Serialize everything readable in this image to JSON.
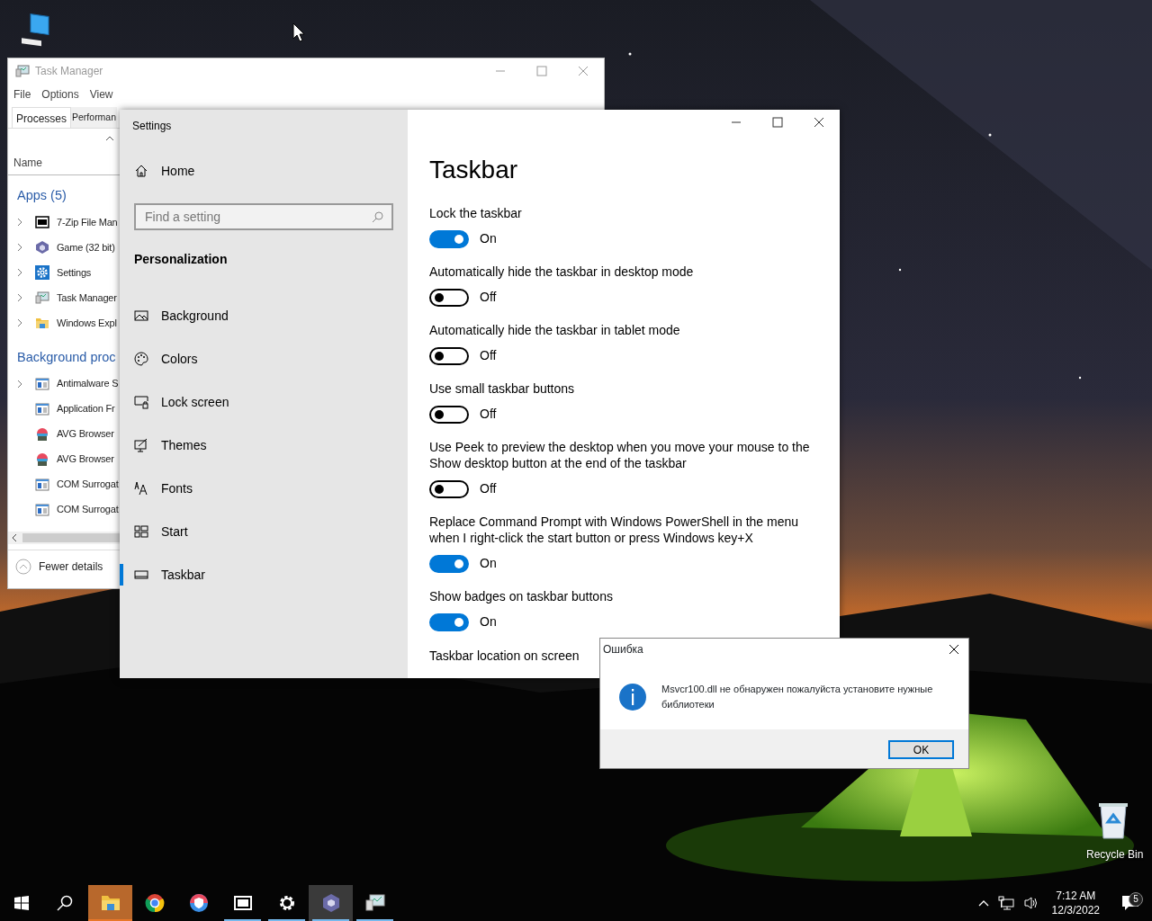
{
  "desktop_icons": [
    {
      "kind": "computer"
    },
    {
      "kind": "recycle_bin",
      "label": "Recycle Bin"
    }
  ],
  "task_manager": {
    "title": "Task Manager",
    "menu": [
      "File",
      "Options",
      "View"
    ],
    "tabs": [
      {
        "label": "Processes",
        "selected": true
      },
      {
        "label": "Performan",
        "selected": false
      }
    ],
    "column_header": "Name",
    "groups": [
      {
        "title": "Apps (5)",
        "rows": [
          {
            "label": "7-Zip File Man",
            "kind": "archive",
            "expandable": true
          },
          {
            "label": "Game (32 bit)",
            "kind": "cube",
            "expandable": true
          },
          {
            "label": "Settings",
            "kind": "gear",
            "expandable": true
          },
          {
            "label": "Task Manager",
            "kind": "monitor",
            "expandable": true
          },
          {
            "label": "Windows Expl",
            "kind": "folder",
            "expandable": true
          }
        ]
      },
      {
        "title": "Background proc",
        "rows": [
          {
            "label": "Antimalware S",
            "kind": "service",
            "expandable": true
          },
          {
            "label": "Application Fr",
            "kind": "service",
            "expandable": false
          },
          {
            "label": "AVG Browser",
            "kind": "ball",
            "expandable": false
          },
          {
            "label": "AVG Browser",
            "kind": "ball",
            "expandable": false
          },
          {
            "label": "COM Surrogat",
            "kind": "service",
            "expandable": false
          },
          {
            "label": "COM Surrogat",
            "kind": "service",
            "expandable": false
          }
        ]
      }
    ],
    "footer": "Fewer details"
  },
  "settings": {
    "title": "Settings",
    "home": "Home",
    "search": {
      "placeholder": "Find a setting"
    },
    "section": "Personalization",
    "nav": [
      {
        "label": "Background",
        "kind": "picture",
        "selected": false
      },
      {
        "label": "Colors",
        "kind": "palette",
        "selected": false
      },
      {
        "label": "Lock screen",
        "kind": "lock",
        "selected": false
      },
      {
        "label": "Themes",
        "kind": "brush",
        "selected": false
      },
      {
        "label": "Fonts",
        "kind": "fonts",
        "selected": false
      },
      {
        "label": "Start",
        "kind": "tiles",
        "selected": false
      },
      {
        "label": "Taskbar",
        "kind": "bar",
        "selected": true
      }
    ],
    "heading": "Taskbar",
    "options": [
      {
        "label": "Lock the taskbar",
        "on": true,
        "state": "On"
      },
      {
        "label": "Automatically hide the taskbar in desktop mode",
        "on": false,
        "state": "Off"
      },
      {
        "label": "Automatically hide the taskbar in tablet mode",
        "on": false,
        "state": "Off"
      },
      {
        "label": "Use small taskbar buttons",
        "on": false,
        "state": "Off"
      },
      {
        "label": "Use Peek to preview the desktop when you move your mouse to the Show desktop button at the end of the taskbar",
        "on": false,
        "state": "Off"
      },
      {
        "label": "Replace Command Prompt with Windows PowerShell in the menu when I right-click the start button or press Windows key+X",
        "on": true,
        "state": "On"
      },
      {
        "label": "Show badges on taskbar buttons",
        "on": true,
        "state": "On"
      }
    ],
    "last_label": "Taskbar location on screen"
  },
  "dialog": {
    "title": "Ошибка",
    "message": "Msvcr100.dll не обнаружен пожалуйста установите нужные библиотеки",
    "button": "OK"
  },
  "taskbar": {
    "apps": [
      {
        "kind": "folder",
        "running": false,
        "active": false,
        "flashing": true
      },
      {
        "kind": "ring",
        "running": false,
        "active": false,
        "flashing": false
      },
      {
        "kind": "shield",
        "running": false,
        "active": false,
        "flashing": false
      },
      {
        "kind": "archive",
        "running": true,
        "active": false,
        "flashing": false
      },
      {
        "kind": "gear",
        "running": true,
        "active": false,
        "flashing": false
      },
      {
        "kind": "cube",
        "running": true,
        "active": true,
        "flashing": false
      },
      {
        "kind": "monitor",
        "running": true,
        "active": false,
        "flashing": false
      }
    ],
    "time": "7:12 AM",
    "date": "12/3/2022",
    "notifications": "5"
  }
}
